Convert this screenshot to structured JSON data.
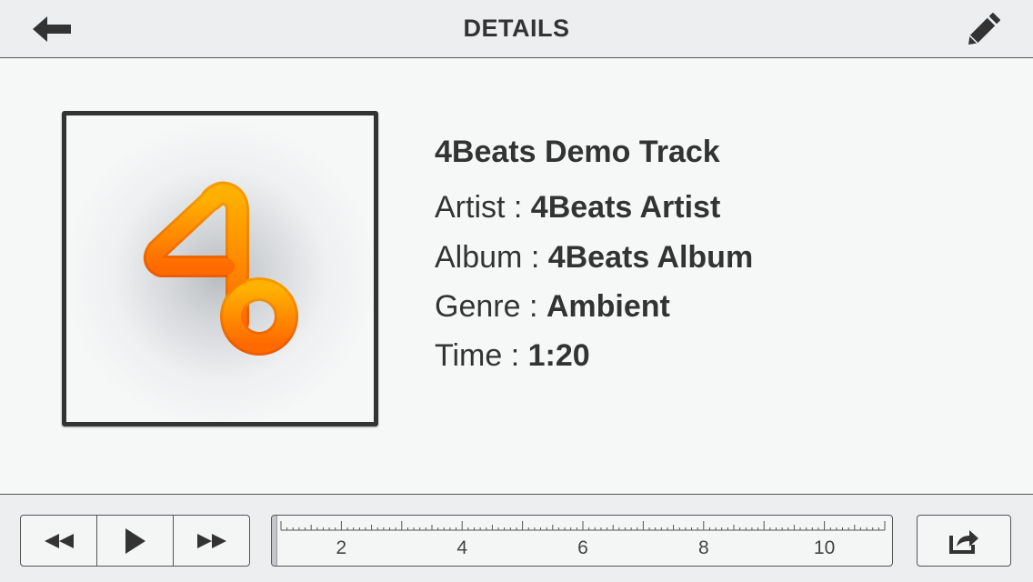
{
  "header": {
    "title": "DETAILS",
    "back_icon": "back-arrow-icon",
    "edit_icon": "pencil-icon"
  },
  "track": {
    "title": "4Beats Demo Track",
    "artist_label": "Artist : ",
    "artist": "4Beats Artist",
    "album_label": "Album : ",
    "album": "4Beats Album",
    "genre_label": "Genre : ",
    "genre": "Ambient",
    "time_label": "Time : ",
    "time": "1:20",
    "artwork_icon": "4beats-logo-icon"
  },
  "controls": {
    "rewind_icon": "rewind-icon",
    "play_icon": "play-icon",
    "fast_forward_icon": "fast-forward-icon",
    "share_icon": "share-icon"
  },
  "timeline": {
    "labels": [
      "2",
      "4",
      "6",
      "8",
      "10"
    ]
  },
  "colors": {
    "accent_orange": "#ff8a00",
    "accent_orange_light": "#ffb400",
    "text": "#333333"
  }
}
